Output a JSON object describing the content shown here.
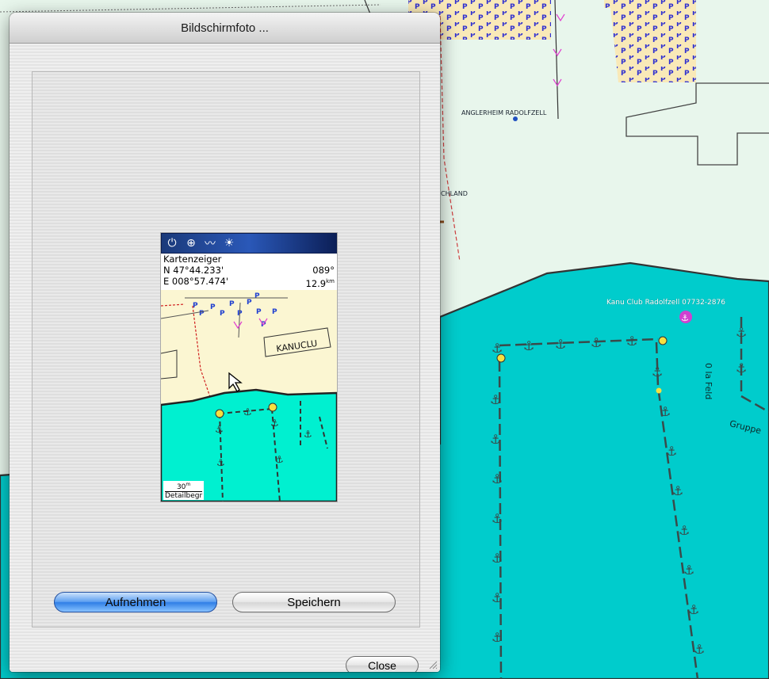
{
  "dialog": {
    "title": "Bildschirmfoto ...",
    "capture_button": "Aufnehmen",
    "save_button": "Speichern",
    "close_button": "Close"
  },
  "gps_screen": {
    "toolbar_icons": [
      "power-plug-icon",
      "satellite-icon",
      "track-icon",
      "backlight-icon"
    ],
    "pointer_label": "Kartenzeiger",
    "lat": "N  47°44.233'",
    "lon": "E 008°57.474'",
    "bearing": "089°",
    "distance": "12.9",
    "distance_unit": "km",
    "map_label": "KANUCLU",
    "scale_value": "30",
    "scale_unit": "m",
    "detail_label": "Detailbegr"
  },
  "background_map": {
    "labels": {
      "angler": "ANGLERHEIM RADOLFZELL",
      "chland": "CHLAND",
      "kanu": "Kanu Club Radolfzell 07732-2876",
      "feld": "0 la Feld",
      "gruppe": "Gruppe"
    },
    "parking_letter": "P",
    "colors": {
      "land": "#e8f6ec",
      "water": "#00cccc",
      "parking": "#f9e9b8",
      "parking_text": "#3030d0"
    }
  }
}
